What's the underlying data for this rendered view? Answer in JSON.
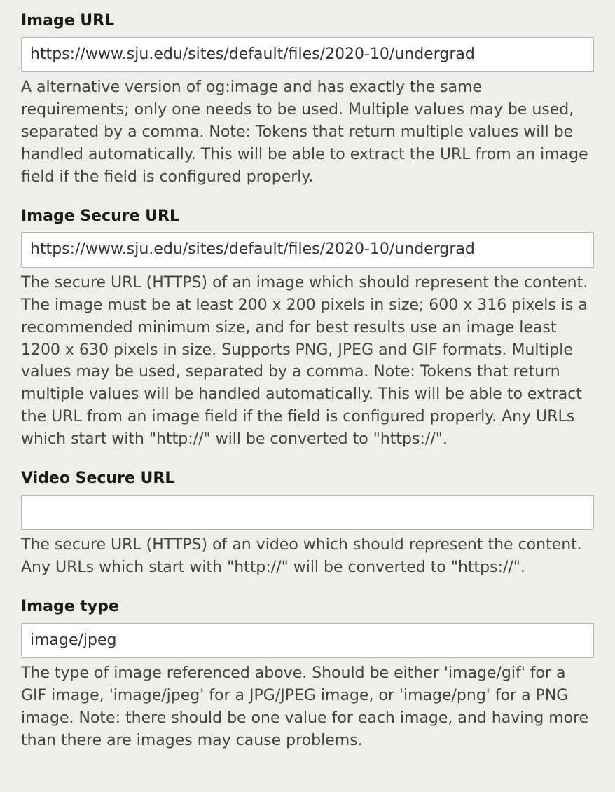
{
  "fields": {
    "image_url": {
      "label": "Image URL",
      "value": "https://www.sju.edu/sites/default/files/2020-10/undergrad",
      "description": "A alternative version of og:image and has exactly the same requirements; only one needs to be used. Multiple values may be used, separated by a comma. Note: Tokens that return multiple values will be handled automatically. This will be able to extract the URL from an image field if the field is configured properly."
    },
    "image_secure_url": {
      "label": "Image Secure URL",
      "value": "https://www.sju.edu/sites/default/files/2020-10/undergrad",
      "description": "The secure URL (HTTPS) of an image which should represent the content. The image must be at least 200 x 200 pixels in size; 600 x 316 pixels is a recommended minimum size, and for best results use an image least 1200 x 630 pixels in size. Supports PNG, JPEG and GIF formats. Multiple values may be used, separated by a comma. Note: Tokens that return multiple values will be handled automatically. This will be able to extract the URL from an image field if the field is configured properly. Any URLs which start with \"http://\" will be converted to \"https://\"."
    },
    "video_secure_url": {
      "label": "Video Secure URL",
      "value": "",
      "description": "The secure URL (HTTPS) of an video which should represent the content. Any URLs which start with \"http://\" will be converted to \"https://\"."
    },
    "image_type": {
      "label": "Image type",
      "value": "image/jpeg",
      "description": "The type of image referenced above. Should be either 'image/gif' for a GIF image, 'image/jpeg' for a JPG/JPEG image, or 'image/png' for a PNG image. Note: there should be one value for each image, and having more than there are images may cause problems."
    }
  }
}
